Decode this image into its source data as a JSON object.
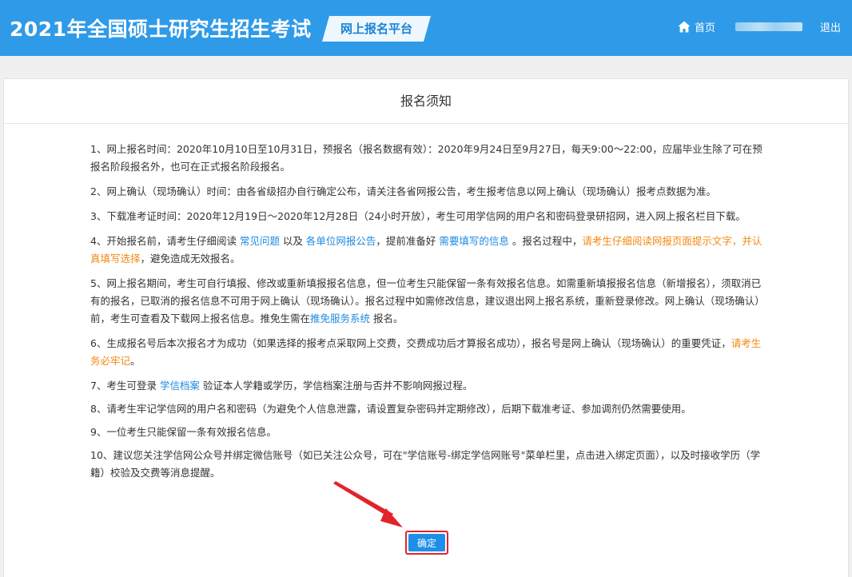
{
  "header": {
    "site_title": "2021年全国硕士研究生招生考试",
    "platform_label": "网上报名平台",
    "home_label": "首页",
    "logout_label": "退出"
  },
  "panel": {
    "title": "报名须知"
  },
  "notices": {
    "n1": "1、网上报名时间：2020年10月10日至10月31日，预报名（报名数据有效）：2020年9月24日至9月27日，每天9:00～22:00，应届毕业生除了可在预报名阶段报名外，也可在正式报名阶段报名。",
    "n2": "2、网上确认（现场确认）时间：由各省级招办自行确定公布，请关注各省网报公告，考生报考信息以网上确认（现场确认）报考点数据为准。",
    "n3": "3、下载准考证时间：2020年12月19日～2020年12月28日（24小时开放），考生可用学信网的用户名和密码登录研招网，进入网上报名栏目下载。",
    "n4": {
      "p1": "4、开始报名前，请考生仔细阅读 ",
      "link1": "常见问题",
      "p2": " 以及 ",
      "link2": "各单位网报公告",
      "p3": "，提前准备好 ",
      "link3": "需要填写的信息",
      "p4": " 。报名过程中，",
      "warn": "请考生仔细阅读网报页面提示文字，并认真填写选择",
      "p5": "，避免造成无效报名。"
    },
    "n5": {
      "p1": "5、网上报名期间，考生可自行填报、修改或重新填报报名信息，但一位考生只能保留一条有效报名信息。如需重新填报报名信息（新增报名），须取消已有的报名，已取消的报名信息不可用于网上确认（现场确认）。报名过程中如需修改信息，建议退出网上报名系统，重新登录修改。网上确认（现场确认）前，考生可查看及下载网上报名信息。推免生需在",
      "link": "推免服务系统",
      "p2": " 报名。"
    },
    "n6": {
      "p1": "6、生成报名号后本次报名才为成功（如果选择的报考点采取网上交费，交费成功后才算报名成功），报名号是网上确认（现场确认）的重要凭证，",
      "warn": "请考生务必牢记",
      "p2": "。"
    },
    "n7": {
      "p1": "7、考生可登录 ",
      "link": "学信档案",
      "p2": " 验证本人学籍或学历，学信档案注册与否并不影响网报过程。"
    },
    "n8": "8、请考生牢记学信网的用户名和密码（为避免个人信息泄露，请设置复杂密码并定期修改），后期下载准考证、参加调剂仍然需要使用。",
    "n9": "9、一位考生只能保留一条有效报名信息。",
    "n10": "10、建议您关注学信网公众号并绑定微信账号（如已关注公众号，可在\"学信账号-绑定学信网账号\"菜单栏里，点击进入绑定页面），以及时接收学历（学籍）校验及交费等消息提醒。"
  },
  "confirm_label": "确定",
  "colors": {
    "header_bg": "#2f9be8",
    "link": "#1e8ae0",
    "warning": "#f08a14",
    "annotation_red": "#e3232c",
    "button_bg": "#1e8fe8"
  },
  "icons": {
    "home": "home-icon",
    "annotation": "red-arrow-annotation-icon"
  }
}
